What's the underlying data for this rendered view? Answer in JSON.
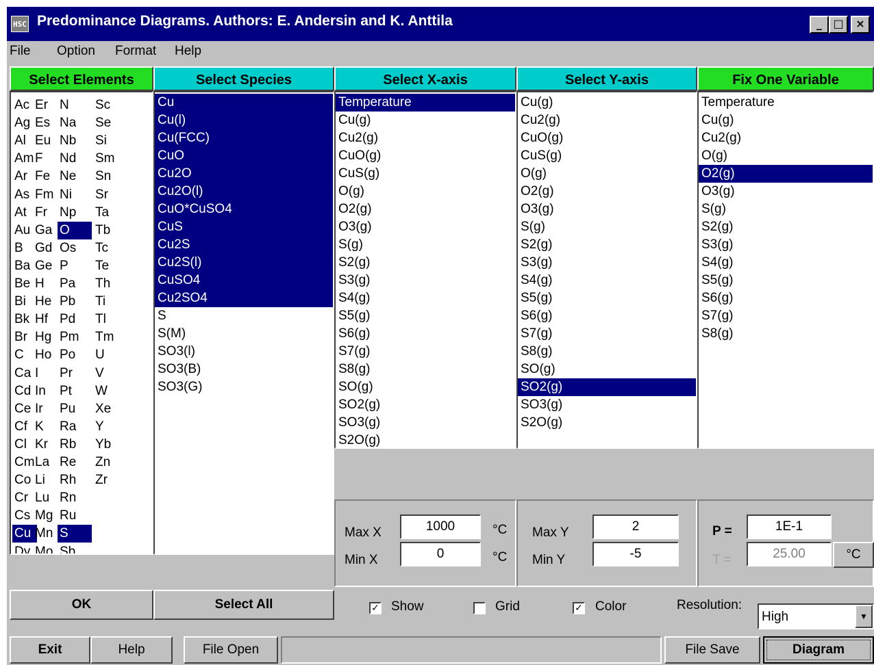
{
  "window": {
    "title": "Predominance Diagrams. Authors: E. Andersin and K. Anttila",
    "icon_label": "HSC",
    "buttons": [
      "_",
      "□",
      "×"
    ]
  },
  "menu": [
    "File",
    "Option",
    "Format",
    "Help"
  ],
  "headers": {
    "elements": "Select Elements",
    "species": "Select Species",
    "xaxis": "Select X-axis",
    "yaxis": "Select Y-axis",
    "fix": "Fix One Variable"
  },
  "elements": [
    [
      "Ac",
      "Er",
      "N",
      "Sc"
    ],
    [
      "Ag",
      "Es",
      "Na",
      "Se"
    ],
    [
      "Al",
      "Eu",
      "Nb",
      "Si"
    ],
    [
      "Am",
      "F",
      "Nd",
      "Sm"
    ],
    [
      "Ar",
      "Fe",
      "Ne",
      "Sn"
    ],
    [
      "As",
      "Fm",
      "Ni",
      "Sr"
    ],
    [
      "At",
      "Fr",
      "Np",
      "Ta"
    ],
    [
      "Au",
      "Ga",
      "O",
      "Tb"
    ],
    [
      "B",
      "Gd",
      "Os",
      "Tc"
    ],
    [
      "Ba",
      "Ge",
      "P",
      "Te"
    ],
    [
      "Be",
      "H",
      "Pa",
      "Th"
    ],
    [
      "Bi",
      "He",
      "Pb",
      "Ti"
    ],
    [
      "Bk",
      "Hf",
      "Pd",
      "Tl"
    ],
    [
      "Br",
      "Hg",
      "Pm",
      "Tm"
    ],
    [
      "C",
      "Ho",
      "Po",
      "U"
    ],
    [
      "Ca",
      "I",
      "Pr",
      "V"
    ],
    [
      "Cd",
      "In",
      "Pt",
      "W"
    ],
    [
      "Ce",
      "Ir",
      "Pu",
      "Xe"
    ],
    [
      "Cf",
      "K",
      "Ra",
      "Y"
    ],
    [
      "Cl",
      "Kr",
      "Rb",
      "Yb"
    ],
    [
      "Cm",
      "La",
      "Re",
      "Zn"
    ],
    [
      "Co",
      "Li",
      "Rh",
      "Zr"
    ],
    [
      "Cr",
      "Lu",
      "Rn",
      ""
    ],
    [
      "Cs",
      "Mg",
      "Ru",
      ""
    ],
    [
      "Cu",
      "Mn",
      "S",
      ""
    ],
    [
      "Dy",
      "Mo",
      "Sb",
      ""
    ]
  ],
  "selected_elements": [
    "O",
    "Cu",
    "S"
  ],
  "species": [
    "Cu",
    "Cu(l)",
    "Cu(FCC)",
    "CuO",
    "Cu2O",
    "Cu2O(l)",
    "CuO*CuSO4",
    "CuS",
    "Cu2S",
    "Cu2S(l)",
    "CuSO4",
    "Cu2SO4",
    "S",
    "S(M)",
    "SO3(l)",
    "SO3(B)",
    "SO3(G)"
  ],
  "species_selected_count": 12,
  "xaxis": [
    "Temperature",
    "Cu(g)",
    "Cu2(g)",
    "CuO(g)",
    "CuS(g)",
    "O(g)",
    "O2(g)",
    "O3(g)",
    "S(g)",
    "S2(g)",
    "S3(g)",
    "S4(g)",
    "S5(g)",
    "S6(g)",
    "S7(g)",
    "S8(g)",
    "SO(g)",
    "SO2(g)",
    "SO3(g)",
    "S2O(g)"
  ],
  "xaxis_selected": "Temperature",
  "yaxis": [
    "Cu(g)",
    "Cu2(g)",
    "CuO(g)",
    "CuS(g)",
    "O(g)",
    "O2(g)",
    "O3(g)",
    "S(g)",
    "S2(g)",
    "S3(g)",
    "S4(g)",
    "S5(g)",
    "S6(g)",
    "S7(g)",
    "S8(g)",
    "SO(g)",
    "SO2(g)",
    "SO3(g)",
    "S2O(g)"
  ],
  "yaxis_selected": "SO2(g)",
  "fix": [
    "Temperature",
    "Cu(g)",
    "Cu2(g)",
    "O(g)",
    "O2(g)",
    "O3(g)",
    "S(g)",
    "S2(g)",
    "S3(g)",
    "S4(g)",
    "S5(g)",
    "S6(g)",
    "S7(g)",
    "S8(g)"
  ],
  "fix_selected": "O2(g)",
  "range": {
    "maxx_label": "Max X",
    "maxx_value": "1000",
    "maxx_unit": "°C",
    "minx_label": "Min X",
    "minx_value": "0",
    "minx_unit": "°C",
    "maxy_label": "Max Y",
    "maxy_value": "2",
    "miny_label": "Min Y",
    "miny_value": "-5",
    "p_label": "P =",
    "p_value": "1E-1",
    "t_label": "T =",
    "t_value": "25.00",
    "t_unit": "°C"
  },
  "buttons": {
    "ok": "OK",
    "select_all": "Select All",
    "exit": "Exit",
    "help": "Help",
    "file_open": "File Open",
    "file_save": "File Save",
    "diagram": "Diagram"
  },
  "options": {
    "show_label": "Show",
    "show_checked": true,
    "grid_label": "Grid",
    "grid_checked": false,
    "color_label": "Color",
    "color_checked": true,
    "resolution_label": "Resolution:",
    "resolution_value": "High"
  }
}
